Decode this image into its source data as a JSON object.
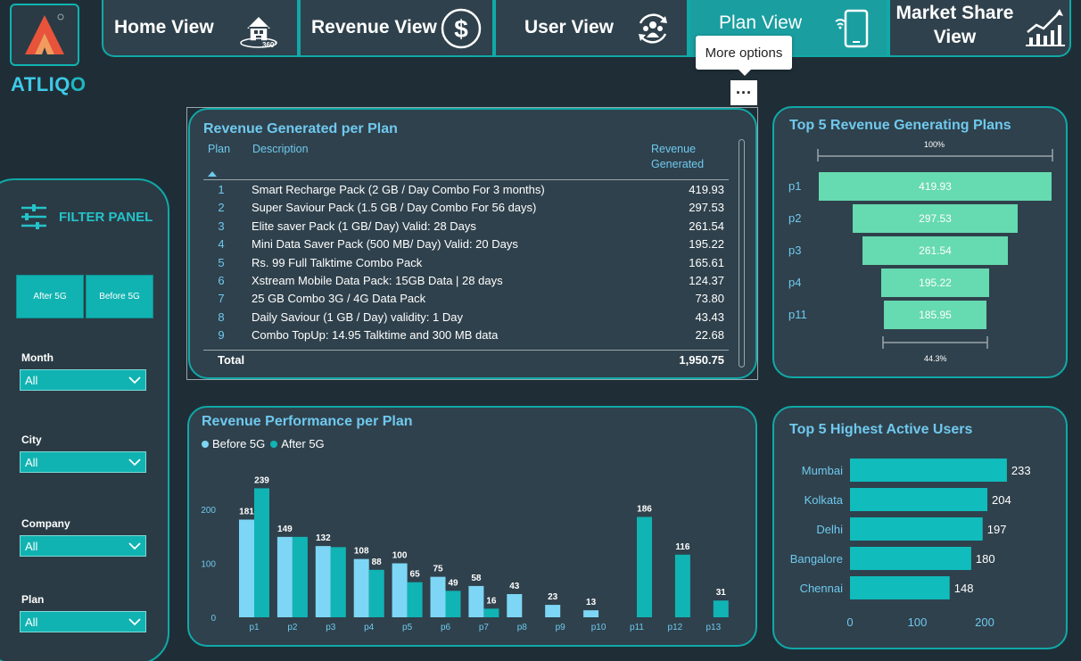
{
  "app": {
    "brand": "ATLIQ",
    "brand_o": "O"
  },
  "nav": {
    "items": [
      {
        "label": "Home View",
        "icon": "home-360-icon"
      },
      {
        "label": "Revenue View",
        "icon": "dollar-icon"
      },
      {
        "label": "User View",
        "icon": "users-cycle-icon"
      },
      {
        "label": "Plan View",
        "icon": "mobile-phone-icon"
      },
      {
        "label": "Market Share View",
        "icon": "growth-chart-icon"
      }
    ],
    "active": "Plan View"
  },
  "tooltip": {
    "text": "More options",
    "button": "···"
  },
  "filter_panel": {
    "title": "FILTER PANEL",
    "toggles": [
      "After 5G",
      "Before 5G"
    ],
    "slicers": [
      {
        "label": "Month",
        "value": "All"
      },
      {
        "label": "City",
        "value": "All"
      },
      {
        "label": "Company",
        "value": "All"
      },
      {
        "label": "Plan",
        "value": "All"
      }
    ]
  },
  "revenue_table": {
    "title": "Revenue Generated per Plan",
    "headers": {
      "plan": "Plan",
      "description": "Description",
      "revenue_line1": "Revenue",
      "revenue_line2": "Generated"
    },
    "rows": [
      {
        "plan": "1",
        "description": "Smart Recharge Pack (2 GB / Day Combo For 3 months)",
        "revenue": "419.93"
      },
      {
        "plan": "2",
        "description": "Super Saviour Pack (1.5 GB / Day Combo For 56 days)",
        "revenue": "297.53"
      },
      {
        "plan": "3",
        "description": "Elite saver Pack (1 GB/ Day) Valid: 28 Days",
        "revenue": "261.54"
      },
      {
        "plan": "4",
        "description": "Mini Data Saver Pack (500 MB/ Day) Valid: 20 Days",
        "revenue": "195.22"
      },
      {
        "plan": "5",
        "description": "Rs. 99 Full Talktime Combo Pack",
        "revenue": "165.61"
      },
      {
        "plan": "6",
        "description": "Xstream Mobile Data Pack: 15GB Data | 28 days",
        "revenue": "124.37"
      },
      {
        "plan": "7",
        "description": "25 GB Combo 3G / 4G Data Pack",
        "revenue": "73.80"
      },
      {
        "plan": "8",
        "description": "Daily Saviour (1 GB / Day) validity: 1 Day",
        "revenue": "43.43"
      },
      {
        "plan": "9",
        "description": "Combo TopUp: 14.95 Talktime and 300 MB data",
        "revenue": "22.68"
      }
    ],
    "total_label": "Total",
    "total_value": "1,950.75"
  },
  "colors": {
    "accent": "#10a9a8",
    "title": "#6fc9ef",
    "before_5g": "#7dd6f5",
    "after_5g": "#11b4b4",
    "funnel": "#66dab0",
    "users_bar": "#10bcbc"
  },
  "chart_data": [
    {
      "type": "funnel",
      "title": "Top 5 Revenue Generating Plans",
      "categories": [
        "p1",
        "p2",
        "p3",
        "p4",
        "p11"
      ],
      "values": [
        419.93,
        297.53,
        261.54,
        195.22,
        185.95
      ],
      "value_labels": [
        "419.93",
        "297.53",
        "261.54",
        "195.22",
        "185.95"
      ],
      "top_label": "100%",
      "bottom_label": "44.3%"
    },
    {
      "type": "bar",
      "title": "Revenue Performance per Plan",
      "categories": [
        "p1",
        "p2",
        "p3",
        "p4",
        "p5",
        "p6",
        "p7",
        "p8",
        "p9",
        "p10",
        "p11",
        "p12",
        "p13"
      ],
      "series": [
        {
          "name": "Before 5G",
          "values": [
            181,
            149,
            132,
            108,
            100,
            75,
            58,
            43,
            23,
            13,
            null,
            null,
            null
          ]
        },
        {
          "name": "After 5G",
          "values": [
            239,
            149,
            130,
            88,
            65,
            49,
            16,
            null,
            null,
            null,
            186,
            116,
            31
          ]
        }
      ],
      "series_labels": [
        [
          "181",
          "149",
          "132",
          "108",
          "100",
          "75",
          "58",
          "43",
          "23",
          "13",
          "",
          "",
          ""
        ],
        [
          "239",
          "",
          "",
          "88",
          "65",
          "49",
          "16",
          "",
          "",
          "",
          "186",
          "116",
          "31"
        ]
      ],
      "y_ticks": [
        0,
        100,
        200
      ],
      "ylim": [
        0,
        260
      ],
      "legend": "top-left"
    },
    {
      "type": "bar",
      "orientation": "horizontal",
      "title": "Top 5 Highest Active Users",
      "categories": [
        "Mumbai",
        "Kolkata",
        "Delhi",
        "Bangalore",
        "Chennai"
      ],
      "values": [
        233,
        204,
        197,
        180,
        148
      ],
      "x_ticks": [
        0,
        100,
        200
      ],
      "xlim": [
        0,
        240
      ]
    }
  ]
}
